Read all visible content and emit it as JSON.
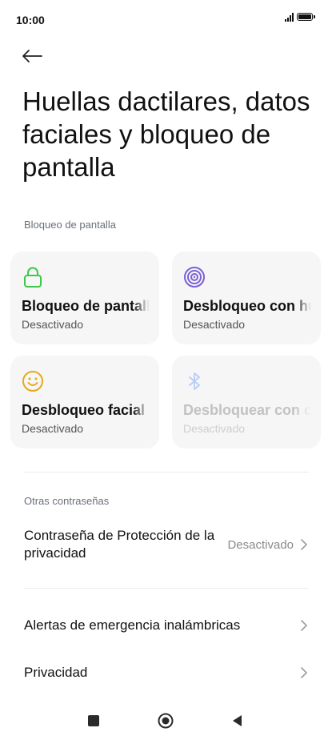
{
  "status": {
    "time": "10:00"
  },
  "page": {
    "title": "Huellas dactilares, datos faciales y bloqueo de pantalla"
  },
  "sections": {
    "screen_lock": "Bloqueo de pantalla",
    "other_passwords": "Otras contraseñas"
  },
  "cards": [
    {
      "title": "Bloqueo de pantalla",
      "status": "Desactivado",
      "icon": "lock-icon",
      "color": "#3ec84a"
    },
    {
      "title": "Desbloqueo con huella",
      "status": "Desactivado",
      "icon": "fingerprint-icon",
      "color": "#7a61d6"
    },
    {
      "title": "Desbloqueo facial",
      "status": "Desactivado",
      "icon": "face-icon",
      "color": "#e7a91c"
    },
    {
      "title": "Desbloquear con dispositivo Bluetooth",
      "status": "Desactivado",
      "icon": "bluetooth-icon",
      "color": "#b9cdf5"
    }
  ],
  "rows": {
    "privacy_password": {
      "label": "Contraseña de Protección de la privacidad",
      "value": "Desactivado"
    },
    "emergency_alerts": {
      "label": "Alertas de emergencia inalámbricas"
    },
    "privacy": {
      "label": "Privacidad"
    }
  }
}
